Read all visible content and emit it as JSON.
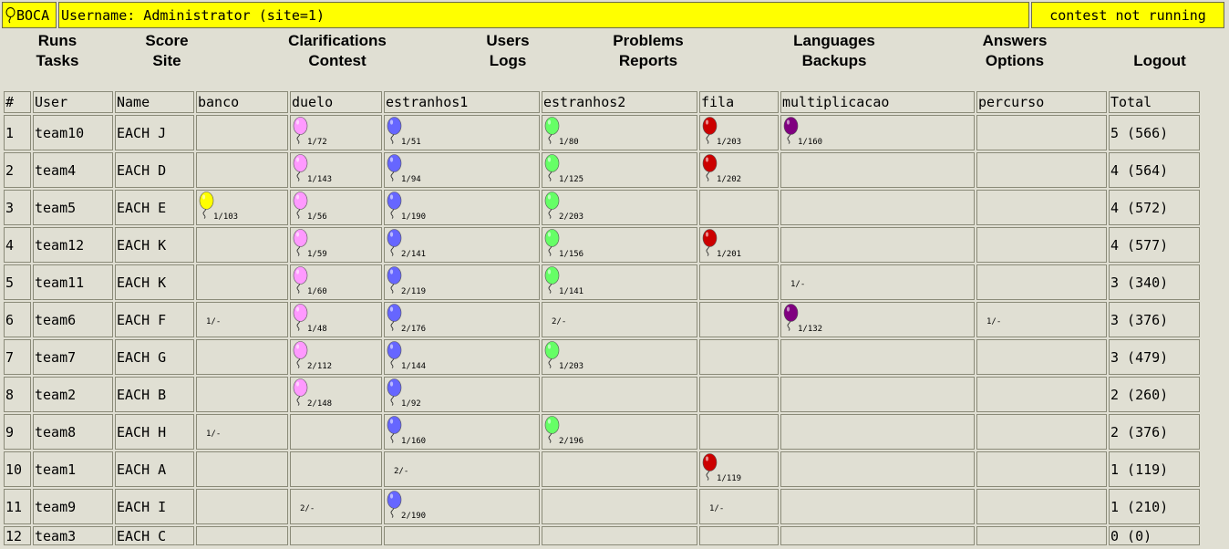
{
  "header": {
    "logo_text": "BOCA",
    "username_line": "Username: Administrator (site=1)",
    "status": "contest not running"
  },
  "menu": [
    {
      "top": "Runs",
      "bottom": "Tasks"
    },
    {
      "top": "Score",
      "bottom": "Site"
    },
    {
      "top": "Clarifications",
      "bottom": "Contest"
    },
    {
      "top": "Users",
      "bottom": "Logs"
    },
    {
      "top": "Problems",
      "bottom": "Reports"
    },
    {
      "top": "Languages",
      "bottom": "Backups"
    },
    {
      "top": "Answers",
      "bottom": "Options"
    },
    {
      "top": "",
      "bottom": "Logout"
    }
  ],
  "columns": [
    "#",
    "User",
    "Name",
    "banco",
    "duelo",
    "estranhos1",
    "estranhos2",
    "fila",
    "multiplicacao",
    "percurso",
    "Total"
  ],
  "balloon_colors": {
    "banco": "#ffff00",
    "duelo": "#ff99ff",
    "estranhos1": "#6666ff",
    "estranhos2": "#66ff66",
    "fila": "#cc0000",
    "multiplicacao": "#800080",
    "percurso": "#888888"
  },
  "rows": [
    {
      "rank": "1",
      "user": "team10",
      "name": "EACH J",
      "problems": [
        null,
        {
          "s": "1/72",
          "b": true
        },
        {
          "s": "1/51",
          "b": true
        },
        {
          "s": "1/80",
          "b": true
        },
        {
          "s": "1/203",
          "b": true
        },
        {
          "s": "1/160",
          "b": true
        },
        null
      ],
      "total": "5 (566)"
    },
    {
      "rank": "2",
      "user": "team4",
      "name": "EACH D",
      "problems": [
        null,
        {
          "s": "1/143",
          "b": true
        },
        {
          "s": "1/94",
          "b": true
        },
        {
          "s": "1/125",
          "b": true
        },
        {
          "s": "1/202",
          "b": true
        },
        null,
        null
      ],
      "total": "4 (564)"
    },
    {
      "rank": "3",
      "user": "team5",
      "name": "EACH E",
      "problems": [
        {
          "s": "1/103",
          "b": true
        },
        {
          "s": "1/56",
          "b": true
        },
        {
          "s": "1/190",
          "b": true
        },
        {
          "s": "2/203",
          "b": true
        },
        null,
        null,
        null
      ],
      "total": "4 (572)"
    },
    {
      "rank": "4",
      "user": "team12",
      "name": "EACH K",
      "problems": [
        null,
        {
          "s": "1/59",
          "b": true
        },
        {
          "s": "2/141",
          "b": true
        },
        {
          "s": "1/156",
          "b": true
        },
        {
          "s": "1/201",
          "b": true
        },
        null,
        null
      ],
      "total": "4 (577)"
    },
    {
      "rank": "5",
      "user": "team11",
      "name": "EACH K",
      "problems": [
        null,
        {
          "s": "1/60",
          "b": true
        },
        {
          "s": "2/119",
          "b": true
        },
        {
          "s": "1/141",
          "b": true
        },
        null,
        {
          "s": "1/-",
          "b": false
        },
        null
      ],
      "total": "3 (340)"
    },
    {
      "rank": "6",
      "user": "team6",
      "name": "EACH F",
      "problems": [
        {
          "s": "1/-",
          "b": false
        },
        {
          "s": "1/48",
          "b": true
        },
        {
          "s": "2/176",
          "b": true
        },
        {
          "s": "2/-",
          "b": false
        },
        null,
        {
          "s": "1/132",
          "b": true
        },
        {
          "s": "1/-",
          "b": false
        }
      ],
      "total": "3 (376)"
    },
    {
      "rank": "7",
      "user": "team7",
      "name": "EACH G",
      "problems": [
        null,
        {
          "s": "2/112",
          "b": true
        },
        {
          "s": "1/144",
          "b": true
        },
        {
          "s": "1/203",
          "b": true
        },
        null,
        null,
        null
      ],
      "total": "3 (479)"
    },
    {
      "rank": "8",
      "user": "team2",
      "name": "EACH B",
      "problems": [
        null,
        {
          "s": "2/148",
          "b": true
        },
        {
          "s": "1/92",
          "b": true
        },
        null,
        null,
        null,
        null
      ],
      "total": "2 (260)"
    },
    {
      "rank": "9",
      "user": "team8",
      "name": "EACH H",
      "problems": [
        {
          "s": "1/-",
          "b": false
        },
        null,
        {
          "s": "1/160",
          "b": true
        },
        {
          "s": "2/196",
          "b": true
        },
        null,
        null,
        null
      ],
      "total": "2 (376)"
    },
    {
      "rank": "10",
      "user": "team1",
      "name": "EACH A",
      "problems": [
        null,
        null,
        {
          "s": "2/-",
          "b": false
        },
        null,
        {
          "s": "1/119",
          "b": true
        },
        null,
        null
      ],
      "total": "1 (119)"
    },
    {
      "rank": "11",
      "user": "team9",
      "name": "EACH I",
      "problems": [
        null,
        {
          "s": "2/-",
          "b": false
        },
        {
          "s": "2/190",
          "b": true
        },
        null,
        {
          "s": "1/-",
          "b": false
        },
        null,
        null
      ],
      "total": "1 (210)"
    },
    {
      "rank": "12",
      "user": "team3",
      "name": "EACH C",
      "problems": [
        null,
        null,
        null,
        null,
        null,
        null,
        null
      ],
      "total": "0 (0)"
    }
  ]
}
